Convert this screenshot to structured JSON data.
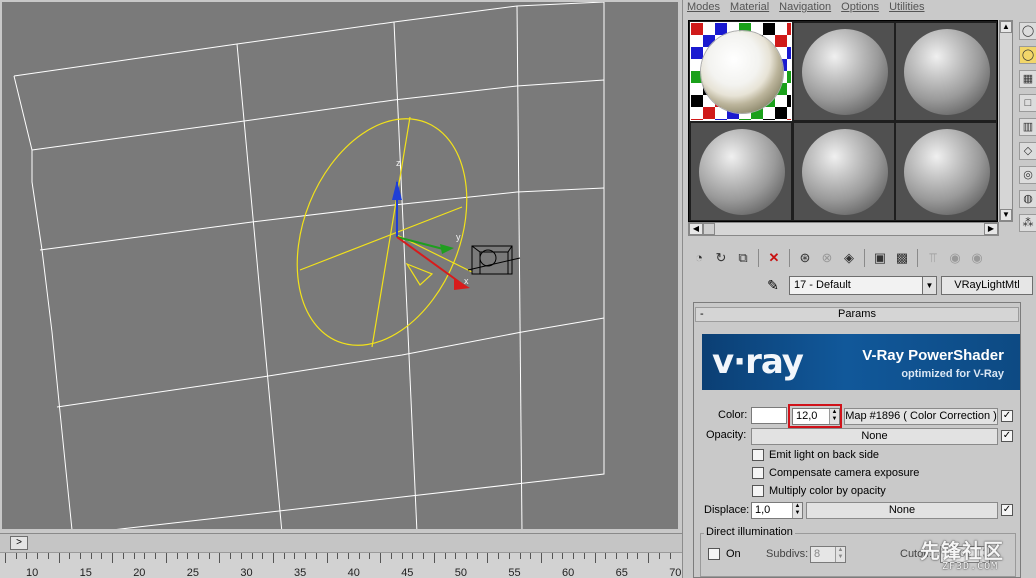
{
  "menubar": {
    "items": [
      "Modes",
      "Material",
      "Navigation",
      "Options",
      "Utilities"
    ]
  },
  "viewport": {
    "axis_labels": {
      "z": "z",
      "y": "y",
      "x": "x"
    },
    "colors": {
      "background": "#7a7a7a",
      "grid": "#ffffff",
      "light_gizmo": "#f2e21a",
      "z_axis": "#1f3fd6",
      "y_axis": "#1f9e1f",
      "x_axis": "#d81b1b"
    }
  },
  "timeline": {
    "slider_button": ">",
    "ruler_labels": [
      "10",
      "15",
      "20",
      "25",
      "30",
      "35",
      "40",
      "45",
      "50",
      "55",
      "60",
      "65",
      "70"
    ]
  },
  "material_slots": {
    "count": 6,
    "active_index": 0
  },
  "side_tools": {
    "icons": [
      "sphere-icon",
      "cylinder-icon",
      "checker-background-icon",
      "box-icon",
      "color-swatch-icon",
      "eraser-icon",
      "pick-object-icon",
      "grid-view-icon",
      "options-icon"
    ]
  },
  "toolbar": {
    "icons": [
      "get-material-icon",
      "put-to-scene-icon",
      "assign-material-icon",
      "reset-map-icon",
      "make-copy-icon",
      "make-unique-icon",
      "put-to-library-icon",
      "material-effects-channel-icon",
      "show-map-in-viewport-icon",
      "show-end-result-icon",
      "go-to-parent-icon",
      "go-forward-to-sibling-icon"
    ],
    "delete_glyph": "✕"
  },
  "material": {
    "name": "17 - Default",
    "type": "VRayLightMtl"
  },
  "params": {
    "rollout_title": "Params",
    "collapse_glyph": "-",
    "banner": {
      "logo": "v·ray",
      "title": "V-Ray PowerShader",
      "subtitle": "optimized for V-Ray"
    },
    "color_label": "Color:",
    "color_value": "12,0",
    "color_map": "Map #1896  ( Color Correction )",
    "opacity_label": "Opacity:",
    "opacity_map": "None",
    "emit_back_side": "Emit light on back side",
    "compensate_exposure": "Compensate camera exposure",
    "multiply_opacity": "Multiply color by opacity",
    "displace_label": "Displace:",
    "displace_value": "1,0",
    "displace_map": "None",
    "direct_illumination": "Direct illumination",
    "on_label": "On",
    "subdivs_label": "Subdivs:",
    "subdivs_value": "8",
    "cutoff_label": "Cutoff:",
    "cutoff_value": "0,001"
  },
  "watermark": {
    "cn": "先锋社区",
    "url": "ZF3D.COM"
  }
}
